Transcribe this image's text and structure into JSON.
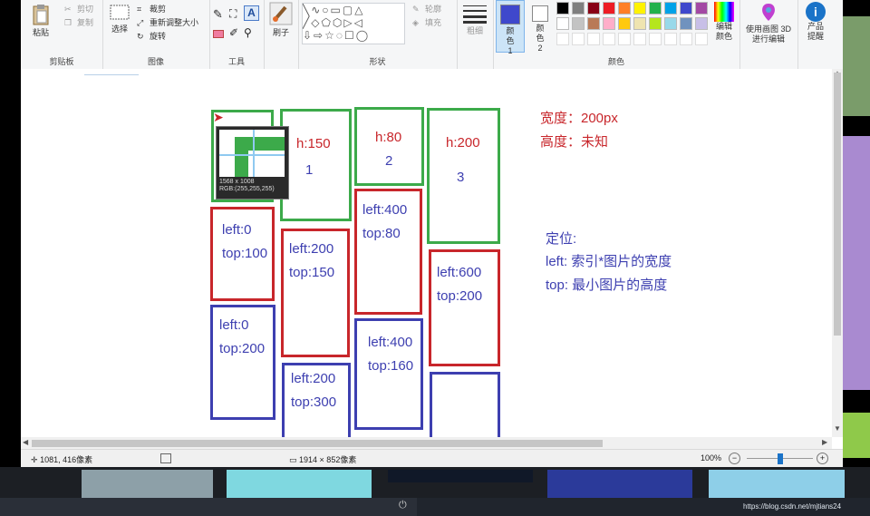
{
  "ribbon": {
    "clipboard": {
      "paste": "粘贴",
      "cut": "剪切",
      "copy": "复制",
      "group": "剪贴板"
    },
    "image": {
      "select": "选择",
      "crop": "裁剪",
      "resize": "重新调整大小",
      "rotate": "旋转",
      "group": "图像"
    },
    "tools": {
      "group": "工具"
    },
    "brushes": {
      "label": "刷子"
    },
    "shapes": {
      "outline": "轮廓",
      "fill": "填充",
      "group": "形状"
    },
    "size": {
      "label": "粗细"
    },
    "colors": {
      "color1": "颜色 1",
      "color2": "颜色 2",
      "edit": "编辑颜色",
      "group": "颜色",
      "swatches_row1": [
        "#000000",
        "#7f7f7f",
        "#880015",
        "#ed1c24",
        "#ff7f27",
        "#fff200",
        "#22b14c",
        "#00a2e8",
        "#3f48cc",
        "#a349a4"
      ],
      "swatches_row2": [
        "#ffffff",
        "#c3c3c3",
        "#b97a57",
        "#ffaec9",
        "#ffc90e",
        "#efe4b0",
        "#b5e61d",
        "#99d9ea",
        "#7092be",
        "#c8bfe7"
      ],
      "color1_value": "#3f48cc",
      "color2_value": "#ffffff"
    },
    "paint3d": {
      "label": "使用画图 3D 进行编辑"
    },
    "product": {
      "label": "产品提醒"
    }
  },
  "canvas": {
    "info_width": "宽度：200px",
    "info_height": "高度：未知",
    "positioning_title": "定位:",
    "positioning_left": "left: 索引*图片的宽度",
    "positioning_top": "top: 最小图片的高度",
    "box1": {
      "height": "h:150",
      "index": "1"
    },
    "box2": {
      "height": "h:80",
      "index": "2"
    },
    "box3": {
      "height": "h:200",
      "index": "3"
    },
    "r1": {
      "left": "left:0",
      "top": "top:100"
    },
    "r2": {
      "left": "left:200",
      "top": "top:150"
    },
    "r3": {
      "left": "left:400",
      "top": "top:80"
    },
    "r4": {
      "left": "left:600",
      "top": "top:200"
    },
    "b1": {
      "left": "left:0",
      "top": "top:200"
    },
    "b2": {
      "left": "left:200",
      "top": "top:300"
    },
    "b3": {
      "left": "left:400",
      "top": "top:160"
    },
    "magnifier": {
      "size": "1568 x 1008",
      "rgb": "RGB:(255,255,255)"
    }
  },
  "status": {
    "cursor_pos": "1081, 416像素",
    "image_size": "1914 × 852像素",
    "zoom": "100%",
    "zoom_level": 0.5
  },
  "watermark": "https://blog.csdn.net/mjtians24"
}
